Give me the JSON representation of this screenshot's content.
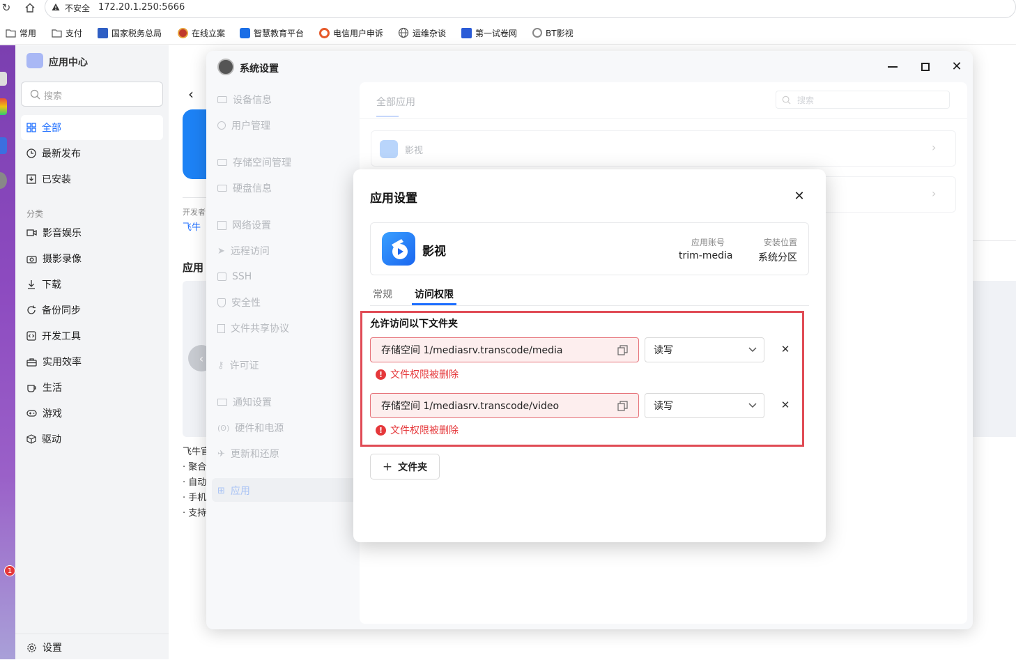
{
  "browser": {
    "security_label": "不安全",
    "url": "172.20.1.250:5666",
    "bookmarks": [
      "常用",
      "支付",
      "国家税务总局",
      "在线立案",
      "智慧教育平台",
      "电信用户申诉",
      "运维杂谈",
      "第一试卷网",
      "BT影视"
    ]
  },
  "app_center": {
    "title": "应用中心",
    "search_placeholder": "搜索",
    "nav": [
      "全部",
      "最新发布",
      "已安装"
    ],
    "category_label": "分类",
    "categories": [
      "影音娱乐",
      "摄影录像",
      "下载",
      "备份同步",
      "开发工具",
      "实用效率",
      "生活",
      "游戏",
      "驱动"
    ],
    "settings_label": "设置",
    "partial": {
      "developer_label": "开发者",
      "developer": "飞牛",
      "app_section": "应用",
      "desc_lines": [
        "飞牛官",
        "· 聚合",
        "· 自动",
        "· 手机",
        "· 支持"
      ]
    },
    "notification_badge": "1"
  },
  "settings_window": {
    "title": "系统设置",
    "nav_groups": [
      [
        "设备信息",
        "用户管理"
      ],
      [
        "存储空间管理",
        "硬盘信息"
      ],
      [
        "网络设置",
        "远程访问",
        "SSH",
        "安全性",
        "文件共享协议"
      ],
      [
        "许可证"
      ],
      [
        "通知设置",
        "硬件和电源",
        "更新和还原"
      ],
      [
        "应用"
      ]
    ],
    "tab": "全部应用",
    "search_placeholder": "搜索",
    "app_rows": [
      "影视",
      ""
    ]
  },
  "modal": {
    "title": "应用设置",
    "app_name": "影视",
    "account_label": "应用账号",
    "account_value": "trim-media",
    "location_label": "安装位置",
    "location_value": "系统分区",
    "tabs": [
      "常规",
      "访问权限"
    ],
    "active_tab": "访问权限",
    "section_title": "允许访问以下文件夹",
    "folders": [
      {
        "path": "存储空间 1/mediasrv.transcode/media",
        "permission": "读写",
        "error": "文件权限被删除"
      },
      {
        "path": "存储空间 1/mediasrv.transcode/video",
        "permission": "读写",
        "error": "文件权限被删除"
      }
    ],
    "add_folder_label": "文件夹"
  },
  "colors": {
    "accent": "#1f6fff",
    "error": "#e5383b",
    "highlight_box": "#e04b55"
  }
}
